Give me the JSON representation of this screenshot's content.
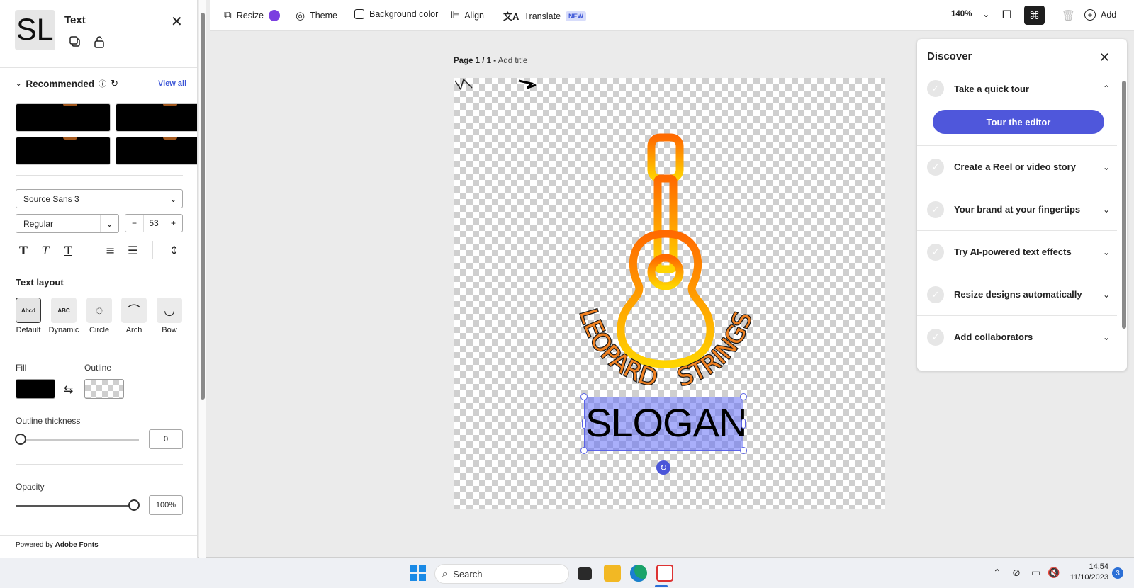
{
  "left_panel": {
    "title": "Text",
    "thumb_text": "SLO",
    "recommended_label": "Recommended",
    "view_all": "View all",
    "font_family": "Source Sans 3",
    "font_style": "Regular",
    "font_size": "53",
    "stepper_minus": "−",
    "stepper_plus": "+",
    "text_layout_label": "Text layout",
    "layouts": [
      {
        "label": "Default",
        "preview": "Abcd"
      },
      {
        "label": "Dynamic",
        "preview": "ABC"
      },
      {
        "label": "Circle",
        "preview": "◌"
      },
      {
        "label": "Arch",
        "preview": "⌒"
      },
      {
        "label": "Bow",
        "preview": "◡"
      }
    ],
    "fill_label": "Fill",
    "outline_label": "Outline",
    "fill_color": "#000000",
    "outline_thickness_label": "Outline thickness",
    "outline_thickness_value": "0",
    "outline_thickness_level": 0,
    "opacity_label": "Opacity",
    "opacity_value": "100%",
    "opacity_level": 1.0,
    "footer_prefix": "Powered by ",
    "footer_brand": "Adobe Fonts"
  },
  "toolbar": {
    "resize": "Resize",
    "theme": "Theme",
    "background_color": "Background color",
    "align": "Align",
    "translate": "Translate",
    "new_badge": "NEW",
    "zoom": "140%",
    "add": "Add"
  },
  "canvas": {
    "page_label": "Page 1 / 1 -",
    "add_title": "Add title",
    "slogan_text": "SLOGAN",
    "curved_text": "LEOPARD STRINGS",
    "guitar_gradient_top": "#ff6a00",
    "guitar_gradient_bottom": "#ffd400",
    "selection_color": "#5b63e6"
  },
  "discover": {
    "title": "Discover",
    "tour_button": "Tour the editor",
    "items": [
      {
        "label": "Take a quick tour",
        "expanded": true
      },
      {
        "label": "Create a Reel or video story",
        "expanded": false
      },
      {
        "label": "Your brand at your fingertips",
        "expanded": false
      },
      {
        "label": "Try AI-powered text effects",
        "expanded": false
      },
      {
        "label": "Resize designs automatically",
        "expanded": false
      },
      {
        "label": "Add collaborators",
        "expanded": false
      }
    ]
  },
  "taskbar": {
    "search_placeholder": "Search",
    "time": "14:54",
    "date": "11/10/2023",
    "notifications": "3"
  }
}
